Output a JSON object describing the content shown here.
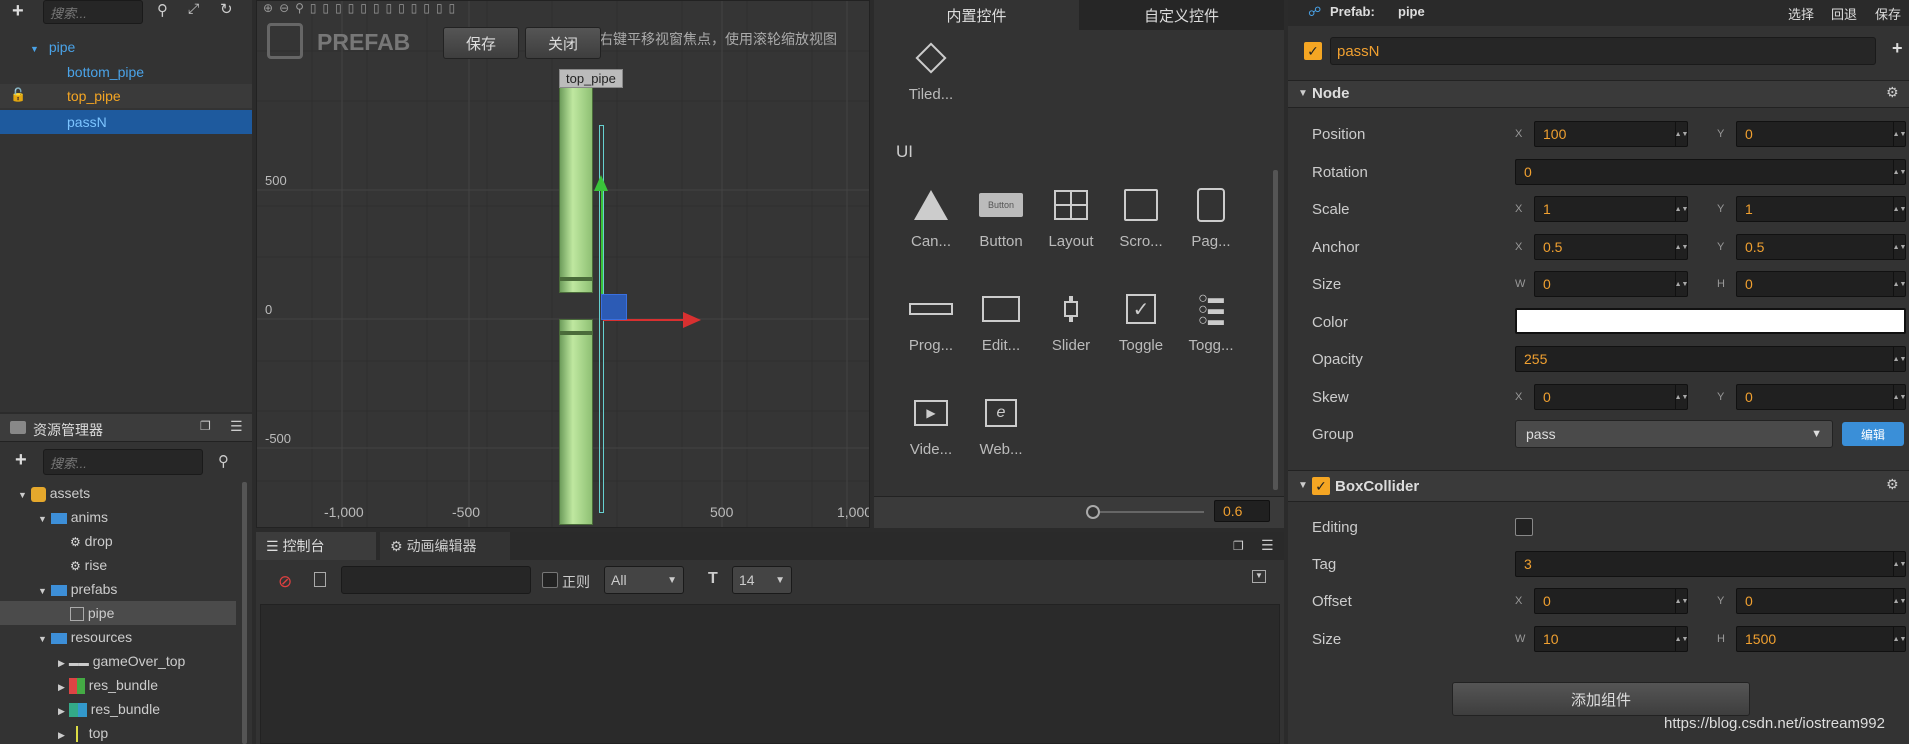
{
  "node_tree": {
    "search_placeholder": "搜索...",
    "items": [
      "pipe",
      "bottom_pipe",
      "top_pipe",
      "passN"
    ]
  },
  "assets": {
    "title": "资源管理器",
    "search_placeholder": "搜索...",
    "items": [
      "assets",
      "anims",
      "drop",
      "rise",
      "prefabs",
      "pipe",
      "resources",
      "gameOver_top",
      "res_bundle",
      "res_bundle",
      "top"
    ]
  },
  "scene": {
    "logo": "PREFAB",
    "save": "保存",
    "close": "关闭",
    "hint": "标右键平移视窗焦点，使用滚轮缩放视图",
    "node_label": "top_pipe",
    "y_ticks": [
      "500",
      "0",
      "-500"
    ],
    "x_ticks": [
      "-1,000",
      "-500",
      "500",
      "1,000"
    ]
  },
  "widgets": {
    "tabs": [
      "内置控件",
      "自定义控件"
    ],
    "tiled": "Tiled...",
    "section": "UI",
    "button_icon_text": "Button",
    "row1": [
      "Can...",
      "Button",
      "Layout",
      "Scro...",
      "Pag..."
    ],
    "row2": [
      "Prog...",
      "Edit...",
      "Slider",
      "Toggle",
      "Togg..."
    ],
    "row3": [
      "Vide...",
      "Web..."
    ],
    "zoom": "0.6"
  },
  "console": {
    "tabs": [
      "控制台",
      "动画编辑器"
    ],
    "regex": "正则",
    "level": "All",
    "font_size": "14"
  },
  "inspector": {
    "prefab_label": "Prefab:",
    "prefab_name": "pipe",
    "actions": [
      "选择",
      "回退",
      "保存"
    ],
    "node_name": "passN",
    "node_section": "Node",
    "labels": [
      "Position",
      "Rotation",
      "Scale",
      "Anchor",
      "Size",
      "Color",
      "Opacity",
      "Skew",
      "Group"
    ],
    "position": [
      "100",
      "0"
    ],
    "rotation": "0",
    "scale": [
      "1",
      "1"
    ],
    "anchor": [
      "0.5",
      "0.5"
    ],
    "size": [
      "0",
      "0"
    ],
    "color": "#ffffff",
    "opacity": "255",
    "skew": [
      "0",
      "0"
    ],
    "group": "pass",
    "edit": "编辑",
    "collider_section": "BoxCollider",
    "collider_labels": [
      "Editing",
      "Tag",
      "Offset",
      "Size"
    ],
    "tag": "3",
    "offset": [
      "0",
      "0"
    ],
    "csize": [
      "10",
      "1500"
    ],
    "add_component": "添加组件"
  },
  "watermark": "https://blog.csdn.net/iostream992"
}
